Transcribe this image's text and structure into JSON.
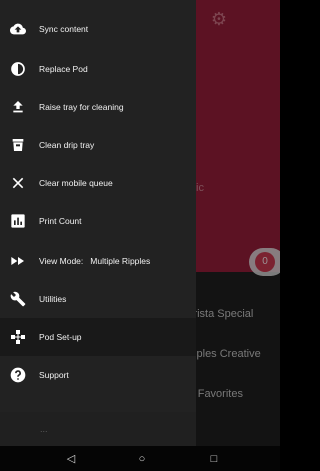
{
  "menu": {
    "items": [
      {
        "icon": "cloud-upload-icon",
        "label": "Sync content"
      },
      {
        "icon": "contrast-icon",
        "label": "Replace Pod"
      },
      {
        "icon": "raise-tray-icon",
        "label": "Raise tray for cleaning"
      },
      {
        "icon": "drip-tray-icon",
        "label": "Clean drip tray"
      },
      {
        "icon": "close-icon",
        "label": "Clear mobile queue"
      },
      {
        "icon": "bar-chart-icon",
        "label": "Print Count"
      },
      {
        "icon": "fast-forward-icon",
        "label": "View Mode:",
        "value": "Multiple Ripples"
      },
      {
        "icon": "wrench-icon",
        "label": "Utilities"
      },
      {
        "icon": "pod-setup-icon",
        "label": "Pod Set-up"
      },
      {
        "icon": "help-icon",
        "label": "Support"
      }
    ],
    "bottom_partial_label": "..."
  },
  "background": {
    "list_items": [
      "Barista Special",
      "Ripples Creative",
      "My Favorites"
    ],
    "partial_text": "ic",
    "toggle_value": "0"
  },
  "colors": {
    "drawer_bg": "#222222",
    "accent_background": "#8e1d36",
    "text": "#f2f2f2"
  },
  "navbar": {
    "back": "◁",
    "home": "○",
    "recents": "□"
  }
}
